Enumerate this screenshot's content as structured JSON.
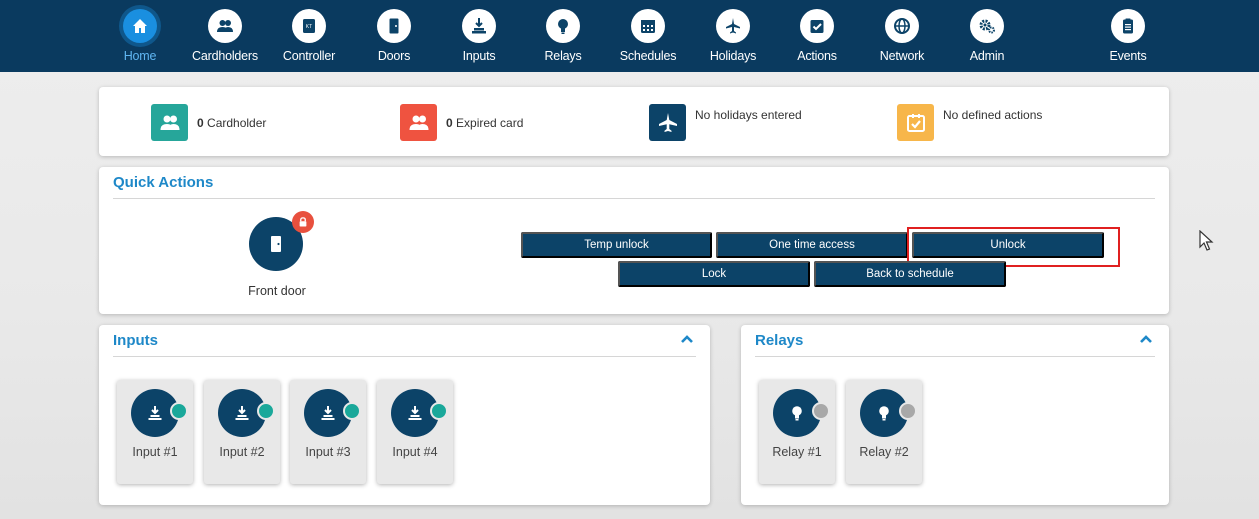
{
  "nav": {
    "items": [
      {
        "label": "Home",
        "icon": "home-icon",
        "active": true
      },
      {
        "label": "Cardholders",
        "icon": "cardholders-icon"
      },
      {
        "label": "Controller",
        "icon": "controller-icon"
      },
      {
        "label": "Doors",
        "icon": "door-icon"
      },
      {
        "label": "Inputs",
        "icon": "input-icon"
      },
      {
        "label": "Relays",
        "icon": "relay-icon"
      },
      {
        "label": "Schedules",
        "icon": "calendar-icon"
      },
      {
        "label": "Holidays",
        "icon": "plane-icon"
      },
      {
        "label": "Actions",
        "icon": "checklist-icon"
      },
      {
        "label": "Network",
        "icon": "globe-icon"
      },
      {
        "label": "Admin",
        "icon": "gears-icon"
      },
      {
        "label": "Events",
        "icon": "clipboard-icon"
      }
    ],
    "controller_badge": "KT"
  },
  "summary": {
    "cardholders": {
      "count": "0",
      "label": "Cardholder",
      "color": "#26a69a"
    },
    "expired": {
      "count": "0",
      "label": "Expired card",
      "color": "#ef5340"
    },
    "holidays": {
      "label": "No holidays entered",
      "color": "#0c4368"
    },
    "actions": {
      "label": "No defined actions",
      "color": "#f7b64a"
    }
  },
  "quick_actions": {
    "title": "Quick Actions",
    "door": {
      "name": "Front door",
      "status_icon": "lock-icon"
    },
    "buttons": {
      "temp_unlock": "Temp unlock",
      "one_time_access": "One time access",
      "unlock": "Unlock",
      "lock": "Lock",
      "back_to_schedule": "Back to schedule"
    }
  },
  "inputs": {
    "title": "Inputs",
    "items": [
      {
        "label": "Input #1",
        "status_color": "#1aa89a"
      },
      {
        "label": "Input #2",
        "status_color": "#1aa89a"
      },
      {
        "label": "Input #3",
        "status_color": "#1aa89a"
      },
      {
        "label": "Input #4",
        "status_color": "#1aa89a"
      }
    ]
  },
  "relays": {
    "title": "Relays",
    "items": [
      {
        "label": "Relay #1",
        "status_color": "#a8a8a8"
      },
      {
        "label": "Relay #2",
        "status_color": "#a8a8a8"
      }
    ]
  },
  "colors": {
    "nav_bg": "#0a3a5f",
    "accent": "#1e88c8",
    "button": "#0c4368",
    "highlight": "#e02020"
  }
}
